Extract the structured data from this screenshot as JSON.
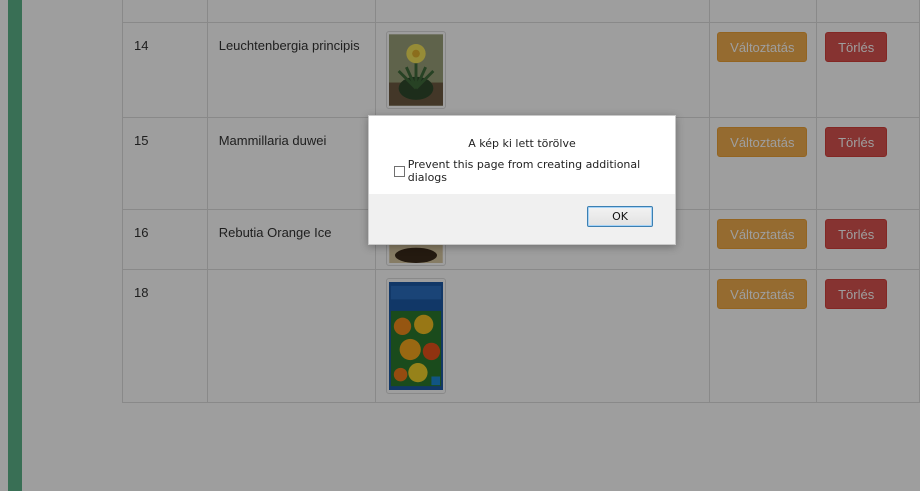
{
  "rows": [
    {
      "id": "14",
      "name": "Leuchtenbergia principis",
      "edit_label": "Változtatás",
      "delete_label": "Törlés"
    },
    {
      "id": "15",
      "name": "Mammillaria duwei",
      "edit_label": "Változtatás",
      "delete_label": "Törlés"
    },
    {
      "id": "16",
      "name": "Rebutia Orange Ice",
      "edit_label": "Változtatás",
      "delete_label": "Törlés"
    },
    {
      "id": "18",
      "name": "",
      "edit_label": "Változtatás",
      "delete_label": "Törlés"
    }
  ],
  "dialog": {
    "message": "A kép ki lett törölve",
    "checkbox_label": "Prevent this page from creating additional dialogs",
    "ok_label": "OK"
  },
  "colors": {
    "sidebar_accent": "#5cb48a",
    "edit_button": "#f0ad4e",
    "delete_button": "#d9534f"
  }
}
